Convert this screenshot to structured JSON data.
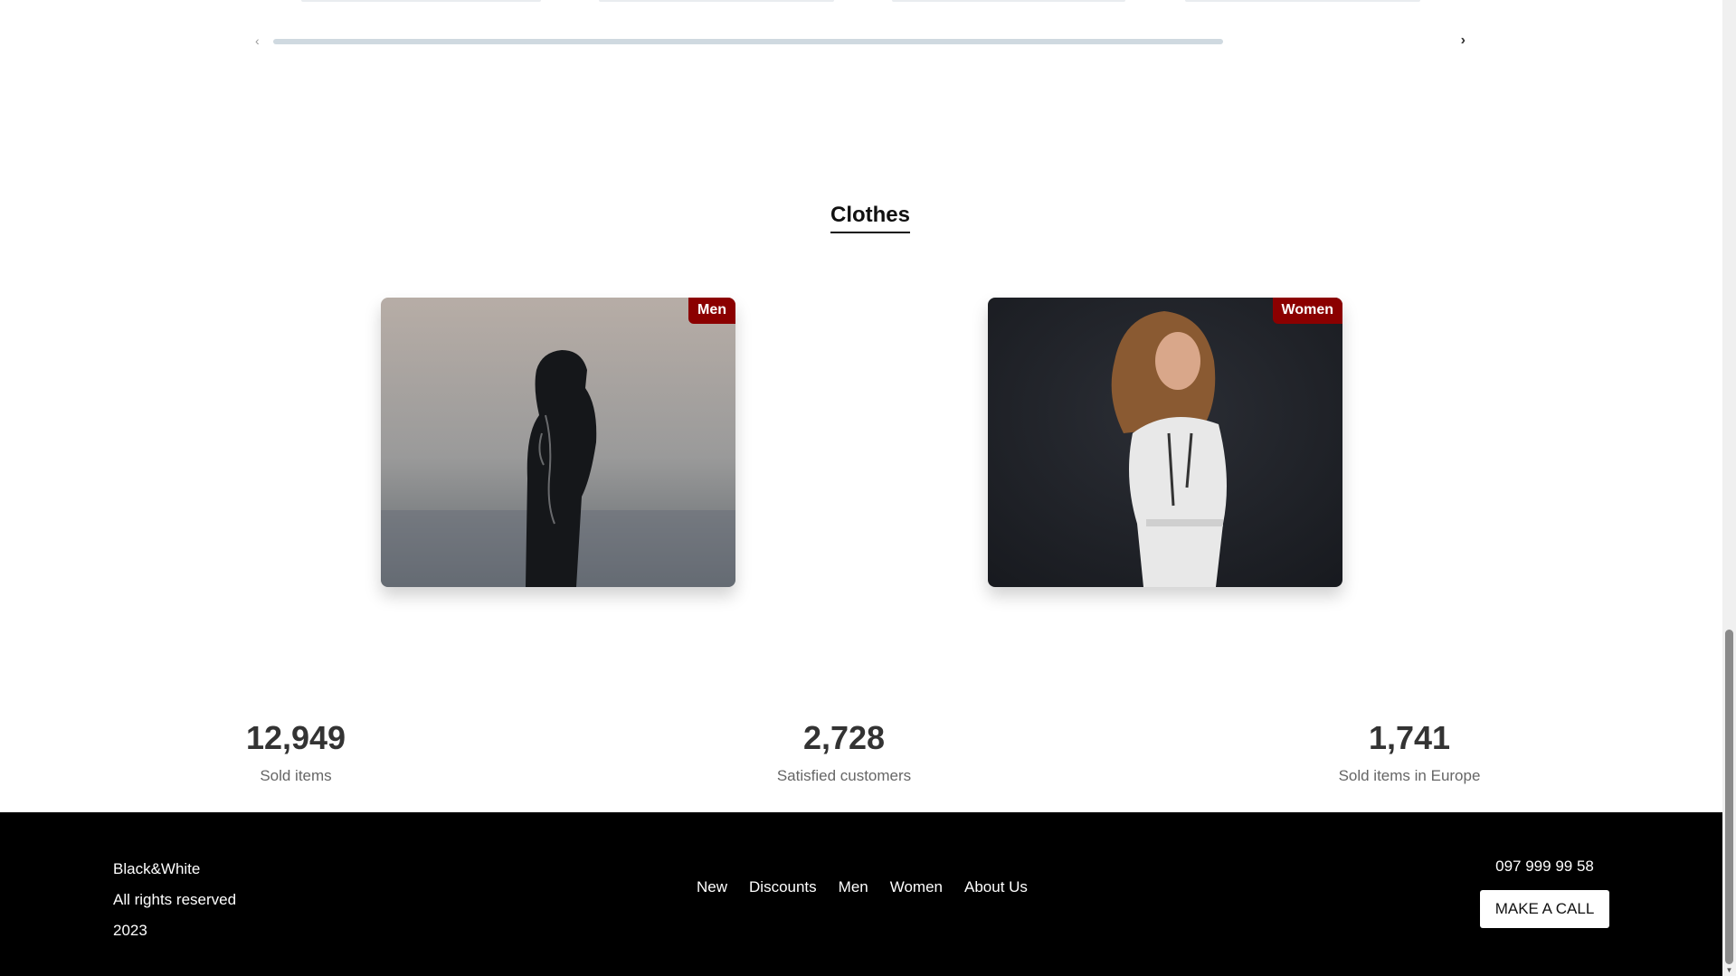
{
  "carousel": {
    "prev_icon": "chevron-left-icon",
    "next_icon": "chevron-right-icon",
    "prev_glyph": "‹",
    "next_glyph": "›"
  },
  "section": {
    "title": "Clothes"
  },
  "categories": [
    {
      "label": "Men"
    },
    {
      "label": "Women"
    }
  ],
  "stats": [
    {
      "value": "12,949",
      "label": "Sold items"
    },
    {
      "value": "2,728",
      "label": "Satisfied customers"
    },
    {
      "value": "1,741",
      "label": "Sold items in Europe"
    }
  ],
  "footer": {
    "brand": "Black&White",
    "rights": "All rights reserved",
    "year": "2023",
    "nav": [
      "New",
      "Discounts",
      "Men",
      "Women",
      "About Us"
    ],
    "phone": "097 999 99 58",
    "call_label": "MAKE A CALL"
  },
  "colors": {
    "badge": "#8b0000",
    "footer_bg": "#000000",
    "scroll_track": "#cfd9e0"
  }
}
